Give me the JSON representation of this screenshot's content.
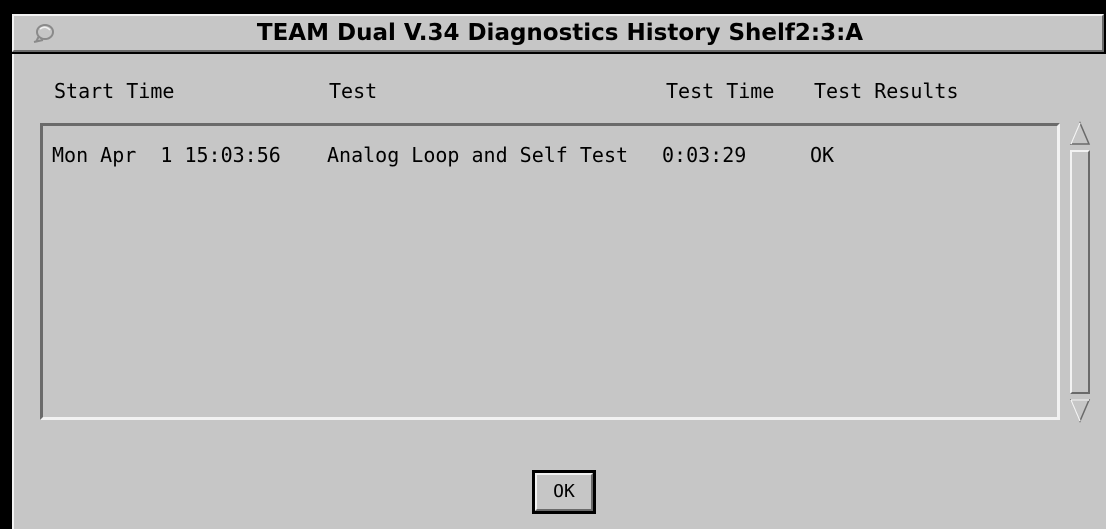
{
  "window": {
    "title": "TEAM Dual V.34 Diagnostics History Shelf2:3:A"
  },
  "icons": {
    "window_menu": "window-menu-icon",
    "scroll_up": "scroll-up-arrow-icon",
    "scroll_down": "scroll-down-arrow-icon"
  },
  "columns": {
    "start_time": "Start Time",
    "test": "Test",
    "test_time": "Test Time",
    "test_results": "Test Results"
  },
  "rows": [
    {
      "start_time": "Mon Apr  1 15:03:56",
      "test": "Analog Loop and Self Test",
      "test_time": "0:03:29",
      "test_results": "OK"
    }
  ],
  "buttons": {
    "ok_label": "OK"
  },
  "colors": {
    "background": "#c6c6c6",
    "highlight": "#f2f2f2",
    "shadow": "#6a6a6a",
    "text": "#000000"
  }
}
